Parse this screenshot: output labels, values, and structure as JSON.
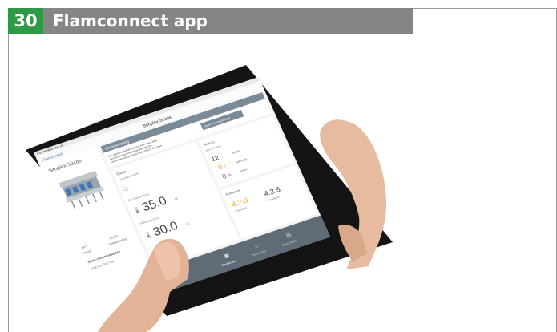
{
  "header": {
    "number": "30",
    "title": "Flamconnect app"
  },
  "tablet": {
    "nav_title": "Simplex Secos",
    "back_label": "Flamconnect",
    "device_name": "Simplex Secos",
    "commissioning": {
      "heading": "Commissioning",
      "message": "It is possible that this device has never been commissioned. Please go through the commissioning process first if that is the case.",
      "button": "Start commissioning"
    },
    "status": {
      "heading": "Status",
      "mode": "Operation mode"
    },
    "supply": {
      "label": "CH Supply temp.",
      "value": "35.0",
      "unit": "°C"
    },
    "return": {
      "label": "CH Return temp.",
      "value": "30.0",
      "unit": "°C"
    },
    "history": {
      "heading": "History",
      "period": "last 30 days",
      "events_count": "12",
      "events_label": "events",
      "warnings_count": "0",
      "warnings_label": "warnings",
      "errors_count": "0",
      "errors_label": "errors"
    },
    "firmware": {
      "heading": "Firmware",
      "installed": "4.2.0",
      "installed_label": "installed",
      "available": "4.2.5",
      "available_label": "available"
    },
    "info": {
      "art_label": "Art #",
      "art_value": "32949",
      "serial_label": "Serial",
      "serial_value": "87N00634RIS",
      "make_offline": "Make content available",
      "total_size": "Total size 93.1 MB"
    },
    "tabs": [
      "Dashboard",
      "Procedures",
      "Documents"
    ],
    "status_time": "9:41 AM",
    "status_date": "Wed May 18"
  },
  "colors": {
    "accent": "#2f9a45",
    "header_bg": "#858585",
    "warning": "#f5a623",
    "error": "#e0322b",
    "device_blue": "#3a76b8"
  }
}
